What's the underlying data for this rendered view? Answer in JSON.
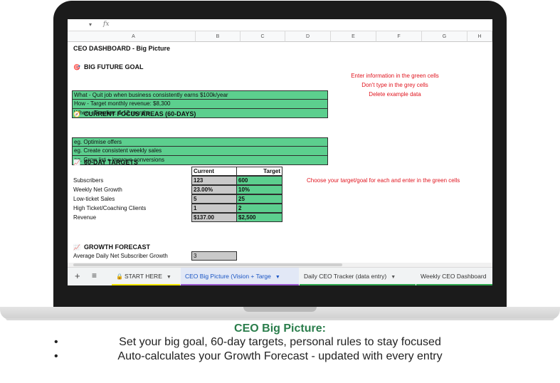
{
  "sheet": {
    "formula_bar": {
      "fx_label": "fx",
      "dropdown": "▾"
    },
    "columns": [
      "A",
      "B",
      "C",
      "D",
      "E",
      "F",
      "G",
      "H"
    ],
    "dashboard_title": "CEO DASHBOARD - Big Picture",
    "big_goal": {
      "icon": "target-icon",
      "heading": "BIG FUTURE GOAL",
      "rows": [
        "What -  Quit job when business consistently earns $100k/year",
        "How -  Target monthly revenue: $8,300",
        "When - Timeline: 6-12 months"
      ]
    },
    "instructions": [
      "Enter information in the green cells",
      "Don't type in the grey cells",
      "Delete example data"
    ],
    "focus": {
      "icon": "compass-icon",
      "heading": "CURRENT FOCUS AREAS (60-DAYS)",
      "rows": [
        "eg. Optimise offers",
        "eg. Create consistent weekly sales",
        "eg. Grow list + improve conversions"
      ]
    },
    "targets": {
      "icon": "chart-icon",
      "heading": "60-DAY TARGETS",
      "col_current": "Current",
      "col_target": "Target",
      "note": "Choose your target/goal for each and enter in the green cells",
      "rows": [
        {
          "label": "Subscribers",
          "current": "123",
          "target": "600"
        },
        {
          "label": "Weekly Net Growth",
          "current": "23.00%",
          "target": "10%"
        },
        {
          "label": "Low-ticket Sales",
          "current": "5",
          "target": "25"
        },
        {
          "label": "High Ticket/Coaching Clients",
          "current": "1",
          "target": "2"
        },
        {
          "label": "Revenue",
          "current": "$137.00",
          "target": "$2,500"
        }
      ]
    },
    "forecast": {
      "icon": "chart-icon",
      "heading": "GROWTH FORECAST",
      "label": "Average Daily Net Subscriber Growth",
      "value": "3"
    },
    "tabs": [
      {
        "label": "START HERE",
        "stripe": "#f2e600"
      },
      {
        "label": "CEO Big Picture (Vision + Targe",
        "stripe": "#9b59d0"
      },
      {
        "label": "Daily CEO Tracker (data entry)",
        "stripe": "#2fa84f"
      },
      {
        "label": "Weekly CEO Dashboard",
        "stripe": "#2fa84f"
      }
    ]
  },
  "caption": {
    "title": "CEO Big Picture:",
    "bullets": [
      "Set your big goal, 60-day targets, personal rules to stay focused",
      "Auto-calculates your Growth Forecast - updated with every entry"
    ]
  }
}
